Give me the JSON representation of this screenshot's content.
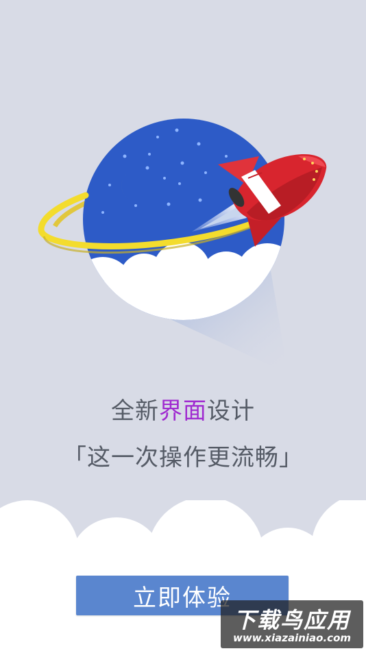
{
  "headline": {
    "prefix": "全新",
    "highlight": "界面",
    "suffix": "设计"
  },
  "subline": "「这一次操作更流畅」",
  "cta_label": "立即体验",
  "watermark": {
    "title": "下载鸟应用",
    "url": "www.xiazainiao.com"
  },
  "colors": {
    "background": "#d8dbe6",
    "planet": "#2d5bc7",
    "ring": "#f3dc2d",
    "rocket": "#d8252e",
    "accent_text": "#a02ad0",
    "button": "#5a86cf"
  },
  "icons": [
    "planet-icon",
    "moon-icon",
    "rocket-icon",
    "cloud-icon"
  ]
}
